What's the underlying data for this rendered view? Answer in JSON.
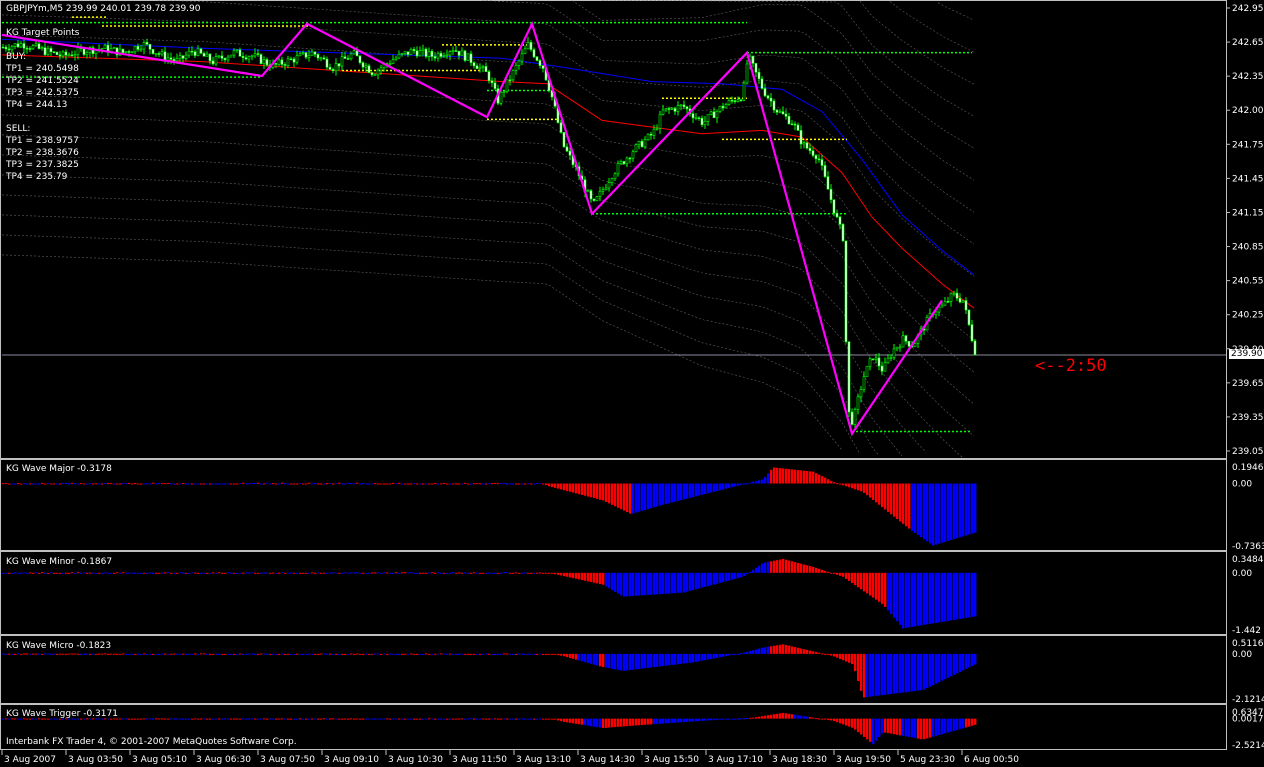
{
  "window": {
    "symbol_header": "GBPJPYm,M5  239.99 240.01 239.78 239.90",
    "footer": "Interbank FX Trader 4, © 2001-2007 MetaQuotes Software Corp."
  },
  "target_points": {
    "title": "KG Target Points",
    "buy_label": "BUY:",
    "buy": [
      "TP1 = 240.5498",
      "TP2 = 241.5524",
      "TP3 = 242.5375",
      "TP4 = 244.13"
    ],
    "sell_label": "SELL:",
    "sell": [
      "TP1 = 238.9757",
      "TP2 = 238.3676",
      "TP3 = 237.3825",
      "TP4 = 235.79"
    ]
  },
  "countdown": "<--2:50",
  "current_price_tag": "239.90",
  "colors": {
    "bull_candle": "#00ff00",
    "zigzag": "#ff00ff",
    "ma_blue": "#0000ff",
    "ma_red": "#ff0000",
    "bands": "#808080",
    "level_green": "#00ff00",
    "level_yellow": "#ffff00",
    "hist_red": "#ff0000",
    "hist_blue": "#0000ff",
    "countdown": "#ff0000"
  },
  "chart_data": [
    {
      "type": "candlestick",
      "name": "main",
      "ylim": [
        238.95,
        243.0
      ],
      "ytick_labels": [
        "242.95",
        "242.65",
        "242.35",
        "242.00",
        "241.75",
        "241.45",
        "241.15",
        "240.85",
        "240.55",
        "240.25",
        "239.90",
        "239.65",
        "239.35",
        "239.05"
      ],
      "x_tick_labels": [
        "3 Aug 2007",
        "3 Aug 03:50",
        "3 Aug 05:10",
        "3 Aug 06:30",
        "3 Aug 07:50",
        "3 Aug 09:10",
        "3 Aug 10:30",
        "3 Aug 11:50",
        "3 Aug 13:10",
        "3 Aug 14:30",
        "3 Aug 15:50",
        "3 Aug 17:10",
        "3 Aug 18:30",
        "3 Aug 19:50",
        "5 Aug 23:30",
        "6 Aug 00:50"
      ],
      "close_path": [
        [
          0,
          242.63
        ],
        [
          20,
          242.66
        ],
        [
          40,
          242.6
        ],
        [
          60,
          242.55
        ],
        [
          80,
          242.6
        ],
        [
          100,
          242.62
        ],
        [
          120,
          242.58
        ],
        [
          140,
          242.66
        ],
        [
          160,
          242.55
        ],
        [
          175,
          242.5
        ],
        [
          190,
          242.6
        ],
        [
          210,
          242.5
        ],
        [
          230,
          242.58
        ],
        [
          250,
          242.55
        ],
        [
          270,
          242.46
        ],
        [
          290,
          242.52
        ],
        [
          310,
          242.58
        ],
        [
          330,
          242.45
        ],
        [
          350,
          242.57
        ],
        [
          370,
          242.4
        ],
        [
          390,
          242.52
        ],
        [
          410,
          242.6
        ],
        [
          430,
          242.55
        ],
        [
          450,
          242.62
        ],
        [
          470,
          242.5
        ],
        [
          485,
          242.38
        ],
        [
          495,
          242.15
        ],
        [
          510,
          242.4
        ],
        [
          525,
          242.65
        ],
        [
          540,
          242.45
        ],
        [
          550,
          242.15
        ],
        [
          560,
          241.75
        ],
        [
          575,
          241.5
        ],
        [
          590,
          241.2
        ],
        [
          610,
          241.5
        ],
        [
          630,
          241.7
        ],
        [
          650,
          241.85
        ],
        [
          660,
          242.05
        ],
        [
          680,
          242.1
        ],
        [
          700,
          241.95
        ],
        [
          720,
          242.1
        ],
        [
          740,
          242.2
        ],
        [
          745,
          242.55
        ],
        [
          760,
          242.25
        ],
        [
          775,
          242.05
        ],
        [
          790,
          241.95
        ],
        [
          800,
          241.75
        ],
        [
          815,
          241.65
        ],
        [
          825,
          241.35
        ],
        [
          835,
          241.05
        ],
        [
          840,
          240.92
        ],
        [
          845,
          239.35
        ],
        [
          850,
          239.25
        ],
        [
          860,
          239.65
        ],
        [
          870,
          239.85
        ],
        [
          880,
          239.72
        ],
        [
          890,
          239.9
        ],
        [
          900,
          240.0
        ],
        [
          910,
          239.95
        ],
        [
          920,
          240.1
        ],
        [
          930,
          240.25
        ],
        [
          940,
          240.3
        ],
        [
          950,
          240.4
        ],
        [
          960,
          240.35
        ],
        [
          972,
          239.9
        ]
      ],
      "zigzag": [
        [
          0,
          242.74
        ],
        [
          260,
          242.37
        ],
        [
          305,
          242.84
        ],
        [
          485,
          242.0
        ],
        [
          530,
          242.84
        ],
        [
          590,
          241.13
        ],
        [
          745,
          242.58
        ],
        [
          850,
          239.15
        ],
        [
          940,
          240.35
        ]
      ],
      "ma_red": [
        [
          0,
          242.56
        ],
        [
          200,
          242.5
        ],
        [
          400,
          242.38
        ],
        [
          500,
          242.32
        ],
        [
          545,
          242.3
        ],
        [
          600,
          241.97
        ],
        [
          700,
          241.85
        ],
        [
          760,
          241.88
        ],
        [
          800,
          241.82
        ],
        [
          840,
          241.5
        ],
        [
          870,
          241.1
        ],
        [
          900,
          240.82
        ],
        [
          940,
          240.5
        ],
        [
          972,
          240.28
        ]
      ],
      "ma_blue": [
        [
          0,
          242.7
        ],
        [
          200,
          242.62
        ],
        [
          400,
          242.56
        ],
        [
          500,
          242.53
        ],
        [
          560,
          242.45
        ],
        [
          650,
          242.32
        ],
        [
          720,
          242.3
        ],
        [
          780,
          242.25
        ],
        [
          820,
          242.05
        ],
        [
          860,
          241.62
        ],
        [
          900,
          241.12
        ],
        [
          940,
          240.8
        ],
        [
          972,
          240.58
        ]
      ],
      "levels": [
        {
          "color": "green",
          "y": 242.85,
          "x": [
            0,
            745
          ]
        },
        {
          "color": "green",
          "y": 242.58,
          "x": [
            745,
            970
          ]
        },
        {
          "color": "green",
          "y": 242.36,
          "x": [
            0,
            260
          ]
        },
        {
          "color": "green",
          "y": 242.24,
          "x": [
            485,
            550
          ]
        },
        {
          "color": "green",
          "y": 241.13,
          "x": [
            590,
            845
          ]
        },
        {
          "color": "green",
          "y": 239.17,
          "x": [
            850,
            970
          ]
        },
        {
          "color": "yellow",
          "y": 242.9,
          "x": [
            70,
            105
          ]
        },
        {
          "color": "yellow",
          "y": 242.82,
          "x": [
            100,
            310
          ]
        },
        {
          "color": "yellow",
          "y": 242.65,
          "x": [
            440,
            530
          ]
        },
        {
          "color": "yellow",
          "y": 242.42,
          "x": [
            340,
            480
          ]
        },
        {
          "color": "yellow",
          "y": 241.98,
          "x": [
            485,
            555
          ]
        },
        {
          "color": "yellow",
          "y": 242.17,
          "x": [
            660,
            745
          ]
        },
        {
          "color": "yellow",
          "y": 241.8,
          "x": [
            720,
            845
          ]
        }
      ]
    },
    {
      "type": "bar",
      "name": "major",
      "title": "KG Wave Major  -0.3178",
      "ylim": [
        -0.7363,
        0.1946
      ],
      "ytick_labels": [
        "0.1946",
        "0.00",
        "-0.7363"
      ],
      "segments": [
        [
          0,
          0.0,
          0.0
        ],
        [
          540,
          0.0,
          -0.03
        ],
        [
          545,
          -0.03,
          -0.2
        ],
        [
          600,
          -0.2,
          -0.36
        ],
        [
          628,
          -0.36,
          -0.25
        ],
        [
          660,
          -0.25,
          -0.1
        ],
        [
          710,
          -0.1,
          0.05
        ],
        [
          760,
          0.05,
          0.19
        ],
        [
          770,
          0.19,
          0.14
        ],
        [
          810,
          0.14,
          0.02
        ],
        [
          830,
          0.02,
          -0.1
        ],
        [
          860,
          -0.1,
          -0.55
        ],
        [
          908,
          -0.55,
          -0.73
        ],
        [
          930,
          -0.73,
          -0.58
        ],
        [
          972,
          -0.58,
          -0.32
        ]
      ],
      "blue_ranges": [
        [
          628,
          765
        ],
        [
          908,
          972
        ]
      ]
    },
    {
      "type": "bar",
      "name": "minor",
      "title": "KG Wave Minor  -0.1867",
      "ylim": [
        -1.442,
        0.3484
      ],
      "ytick_labels": [
        "0.3484",
        "0.00",
        "-1.442"
      ],
      "segments": [
        [
          0,
          0.0,
          0.0
        ],
        [
          545,
          0.0,
          -0.05
        ],
        [
          555,
          -0.05,
          -0.3
        ],
        [
          600,
          -0.3,
          -0.6
        ],
        [
          620,
          -0.6,
          -0.5
        ],
        [
          680,
          -0.5,
          -0.1
        ],
        [
          740,
          -0.1,
          0.25
        ],
        [
          760,
          0.25,
          0.35
        ],
        [
          780,
          0.35,
          0.15
        ],
        [
          810,
          0.15,
          -0.1
        ],
        [
          840,
          -0.1,
          -0.8
        ],
        [
          880,
          -0.8,
          -1.4
        ],
        [
          900,
          -1.4,
          -1.1
        ],
        [
          972,
          -1.1,
          -0.18
        ]
      ],
      "blue_ranges": [
        [
          602,
          765
        ],
        [
          885,
          972
        ]
      ]
    },
    {
      "type": "bar",
      "name": "micro",
      "title": "KG Wave Micro  -0.1823",
      "ylim": [
        -2.1214,
        0.5116
      ],
      "ytick_labels": [
        "0.5116",
        "0.00",
        "-2.1214"
      ],
      "segments": [
        [
          0,
          0.0,
          0.0
        ],
        [
          548,
          0.0,
          -0.1
        ],
        [
          560,
          -0.1,
          -0.6
        ],
        [
          598,
          -0.6,
          -0.8
        ],
        [
          620,
          -0.8,
          -0.4
        ],
        [
          690,
          -0.4,
          0.05
        ],
        [
          740,
          0.05,
          0.3
        ],
        [
          760,
          0.3,
          0.45
        ],
        [
          780,
          0.45,
          -0.1
        ],
        [
          830,
          -0.1,
          -0.5
        ],
        [
          850,
          -0.5,
          -2.05
        ],
        [
          860,
          -2.05,
          -1.7
        ],
        [
          920,
          -1.7,
          -0.5
        ],
        [
          972,
          -0.5,
          -0.18
        ]
      ],
      "blue_ranges": [
        [
          575,
          595
        ],
        [
          602,
          765
        ],
        [
          862,
          972
        ]
      ]
    },
    {
      "type": "bar",
      "name": "trigger",
      "title": "KG Wave Trigger  -0.3171",
      "ylim": [
        -2.5214,
        0.6347
      ],
      "ytick_labels": [
        "0.6347",
        "0.0017",
        "-2.5214"
      ],
      "segments": [
        [
          0,
          0.0,
          0.0
        ],
        [
          548,
          0.0,
          -0.3
        ],
        [
          560,
          -0.3,
          -0.9
        ],
        [
          600,
          -0.9,
          -0.6
        ],
        [
          640,
          -0.6,
          -0.2
        ],
        [
          700,
          -0.2,
          0.1
        ],
        [
          750,
          0.1,
          0.55
        ],
        [
          780,
          0.55,
          -0.2
        ],
        [
          830,
          -0.2,
          -0.9
        ],
        [
          850,
          -0.9,
          -2.45
        ],
        [
          870,
          -2.45,
          -1.3
        ],
        [
          880,
          -1.3,
          -2.0
        ],
        [
          920,
          -2.0,
          -0.6
        ],
        [
          972,
          -0.6,
          -0.32
        ]
      ],
      "blue_ranges": [
        [
          582,
          598
        ],
        [
          650,
          745
        ],
        [
          790,
          805
        ],
        [
          870,
          880
        ],
        [
          900,
          912
        ],
        [
          930,
          960
        ]
      ]
    }
  ]
}
